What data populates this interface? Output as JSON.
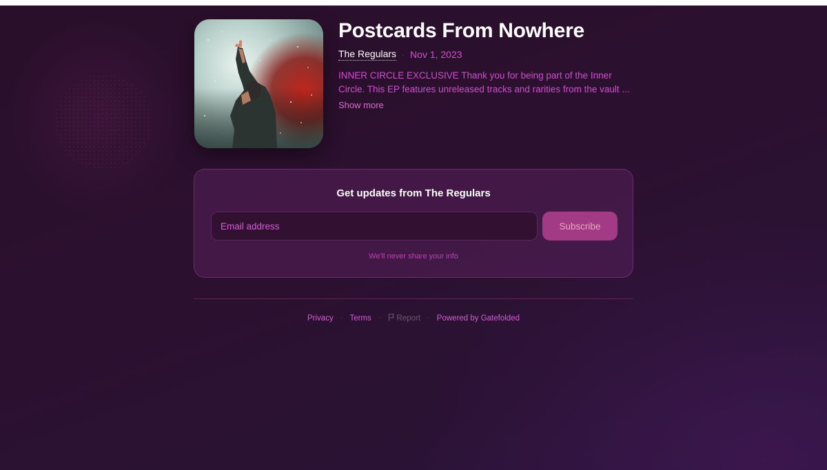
{
  "release": {
    "title": "Postcards From Nowhere",
    "artist": "The Regulars",
    "separator": "·",
    "date": "Nov 1, 2023",
    "description": "INNER CIRCLE EXCLUSIVE Thank you for being part of the Inner Circle. This EP features unreleased tracks and rarities from the vault ...",
    "show_more_label": "Show more",
    "cover_icon": "concert-photo-icon"
  },
  "subscribe": {
    "title": "Get updates from The Regulars",
    "email_placeholder": "Email address",
    "email_value": "",
    "button_label": "Subscribe",
    "note": "We'll never share your info"
  },
  "footer": {
    "privacy": "Privacy",
    "terms": "Terms",
    "report": "Report",
    "report_icon": "flag-icon",
    "powered_by": "Powered by Gatefolded",
    "separator": "·"
  },
  "colors": {
    "background": "#2a0f2a",
    "accent": "#d14fd0",
    "button": "#a33a85"
  }
}
